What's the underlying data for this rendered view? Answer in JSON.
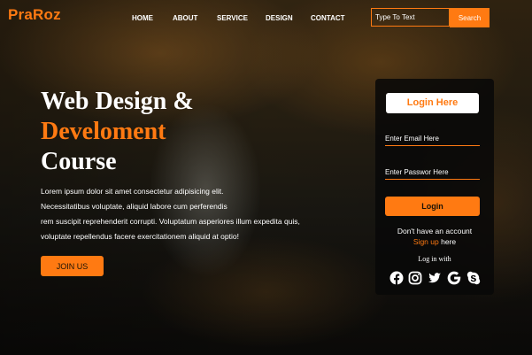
{
  "brand": {
    "logo_text": "PraRoz",
    "accent_color": "#ff7a12"
  },
  "nav": {
    "items": [
      {
        "label": "HOME"
      },
      {
        "label": "ABOUT"
      },
      {
        "label": "SERVICE"
      },
      {
        "label": "DESIGN"
      },
      {
        "label": "CONTACT"
      }
    ]
  },
  "search": {
    "placeholder": "Type To Text",
    "button_label": "Search"
  },
  "hero": {
    "title_line1": "Web Design &",
    "title_line2": "Develoment",
    "title_line3": "Course",
    "paragraph_lines": [
      "Lorem ipsum dolor sit amet consectetur adipisicing elit.",
      "Necessitatibus voluptate, aliquid labore cum perferendis",
      "rem suscipit reprehenderit corrupti. Voluptatum asperiores illum expedita quis,",
      "voluptate repellendus facere exercitationem aliquid at optio!"
    ],
    "join_button_label": "JOIN US"
  },
  "login": {
    "header": "Login Here",
    "email_placeholder": "Enter Email Here",
    "password_placeholder": "Enter Passwor Here",
    "button_label": "Login",
    "no_account_text": "Don't have an account",
    "signup_link": "Sign up",
    "signup_suffix": " here",
    "login_with_label": "Log in with",
    "social_icons": [
      "facebook-icon",
      "instagram-icon",
      "twitter-icon",
      "google-icon",
      "skype-icon"
    ]
  }
}
